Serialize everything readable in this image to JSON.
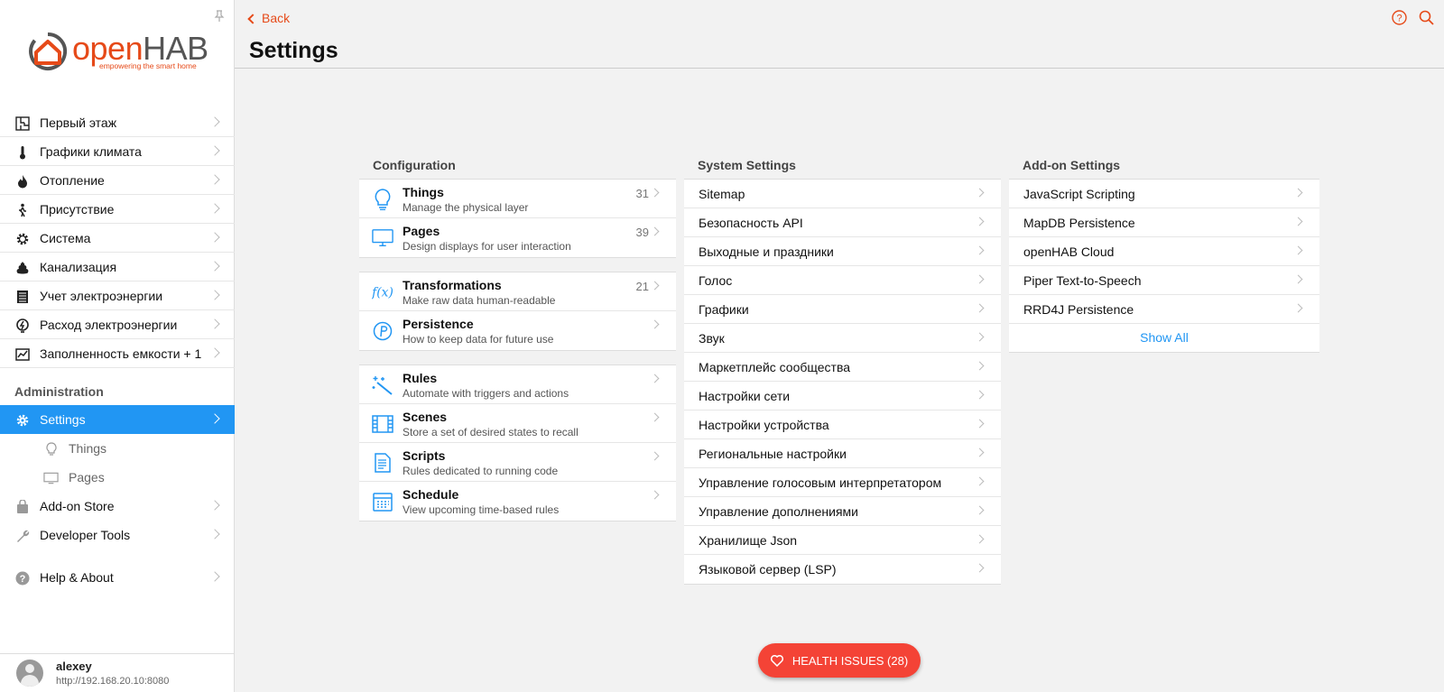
{
  "app": {
    "brand_main": "open",
    "brand_bold": "HAB",
    "tagline": "empowering the smart home"
  },
  "sidebar": {
    "items": [
      {
        "label": "Первый этаж",
        "icon": "floorplan-icon"
      },
      {
        "label": "Графики климата",
        "icon": "thermometer-icon"
      },
      {
        "label": "Отопление",
        "icon": "flame-icon"
      },
      {
        "label": "Присутствие",
        "icon": "walking-person-icon"
      },
      {
        "label": "Система",
        "icon": "gear-icon"
      },
      {
        "label": "Канализация",
        "icon": "poop-icon"
      },
      {
        "label": "Учет электроэнергии",
        "icon": "meter-icon"
      },
      {
        "label": "Расход электроэнергии",
        "icon": "energy-icon"
      },
      {
        "label": "Заполненность емкости + 1",
        "icon": "chart-icon"
      }
    ],
    "admin_title": "Administration",
    "admin": {
      "settings": "Settings",
      "things": "Things",
      "pages": "Pages",
      "addon_store": "Add-on Store",
      "developer_tools": "Developer Tools",
      "help_about": "Help & About"
    },
    "user": {
      "name": "alexey",
      "url": "http://192.168.20.10:8080"
    }
  },
  "header": {
    "back_label": "Back",
    "title": "Settings"
  },
  "configuration": {
    "title": "Configuration",
    "groups": [
      [
        {
          "title": "Things",
          "subtitle": "Manage the physical layer",
          "count": "31"
        },
        {
          "title": "Pages",
          "subtitle": "Design displays for user interaction",
          "count": "39"
        }
      ],
      [
        {
          "title": "Transformations",
          "subtitle": "Make raw data human-readable",
          "count": "21"
        },
        {
          "title": "Persistence",
          "subtitle": "How to keep data for future use",
          "count": ""
        }
      ],
      [
        {
          "title": "Rules",
          "subtitle": "Automate with triggers and actions",
          "count": ""
        },
        {
          "title": "Scenes",
          "subtitle": "Store a set of desired states to recall",
          "count": ""
        },
        {
          "title": "Scripts",
          "subtitle": "Rules dedicated to running code",
          "count": ""
        },
        {
          "title": "Schedule",
          "subtitle": "View upcoming time-based rules",
          "count": ""
        }
      ]
    ]
  },
  "system_settings": {
    "title": "System Settings",
    "items": [
      "Sitemap",
      "Безопасность API",
      "Выходные и праздники",
      "Голос",
      "Графики",
      "Звук",
      "Маркетплейс сообщества",
      "Настройки сети",
      "Настройки устройства",
      "Региональные настройки",
      "Управление голосовым интерпретатором",
      "Управление дополнениями",
      "Хранилище Json",
      "Языковой сервер (LSP)"
    ]
  },
  "addon_settings": {
    "title": "Add-on Settings",
    "items": [
      "JavaScript Scripting",
      "MapDB Persistence",
      "openHAB Cloud",
      "Piper Text-to-Speech",
      "RRD4J Persistence"
    ],
    "show_all": "Show All"
  },
  "health": {
    "label": "HEALTH ISSUES (28)"
  },
  "colors": {
    "accent": "#e64a19",
    "active": "#2196f3",
    "health": "#f44336"
  }
}
